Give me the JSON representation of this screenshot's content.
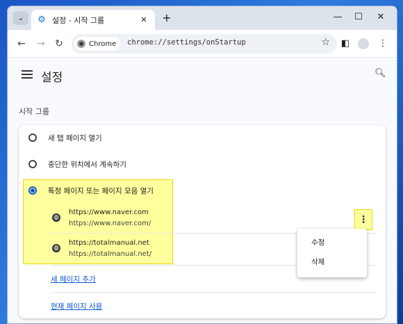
{
  "tab": {
    "title": "설정 - 시작 그룹",
    "favicon": "gear-icon"
  },
  "window_controls": {
    "minimize": "—",
    "maximize": "☐",
    "close": "✕"
  },
  "toolbar": {
    "chip_label": "Chrome",
    "url": "chrome://settings/onStartup"
  },
  "header": {
    "title": "설정"
  },
  "section": {
    "title": "시작 그룹"
  },
  "options": [
    {
      "label": "새 탭 페이지 열기",
      "checked": false
    },
    {
      "label": "중단한 위치에서 계속하기",
      "checked": false
    },
    {
      "label": "특정 페이지 또는 페이지 모음 열기",
      "checked": true
    }
  ],
  "sites": [
    {
      "name": "https://www.naver.com",
      "url": "https://www.naver.com/"
    },
    {
      "name": "https://totalmanual.net",
      "url": "https://totalmanual.net/"
    }
  ],
  "links": {
    "add_page": "새 페이지 추가",
    "use_current": "현재 페이지 사용"
  },
  "context_menu": {
    "edit": "수정",
    "delete": "삭제"
  },
  "colors": {
    "accent": "#0b57d0",
    "highlight": "#ffff9e"
  }
}
